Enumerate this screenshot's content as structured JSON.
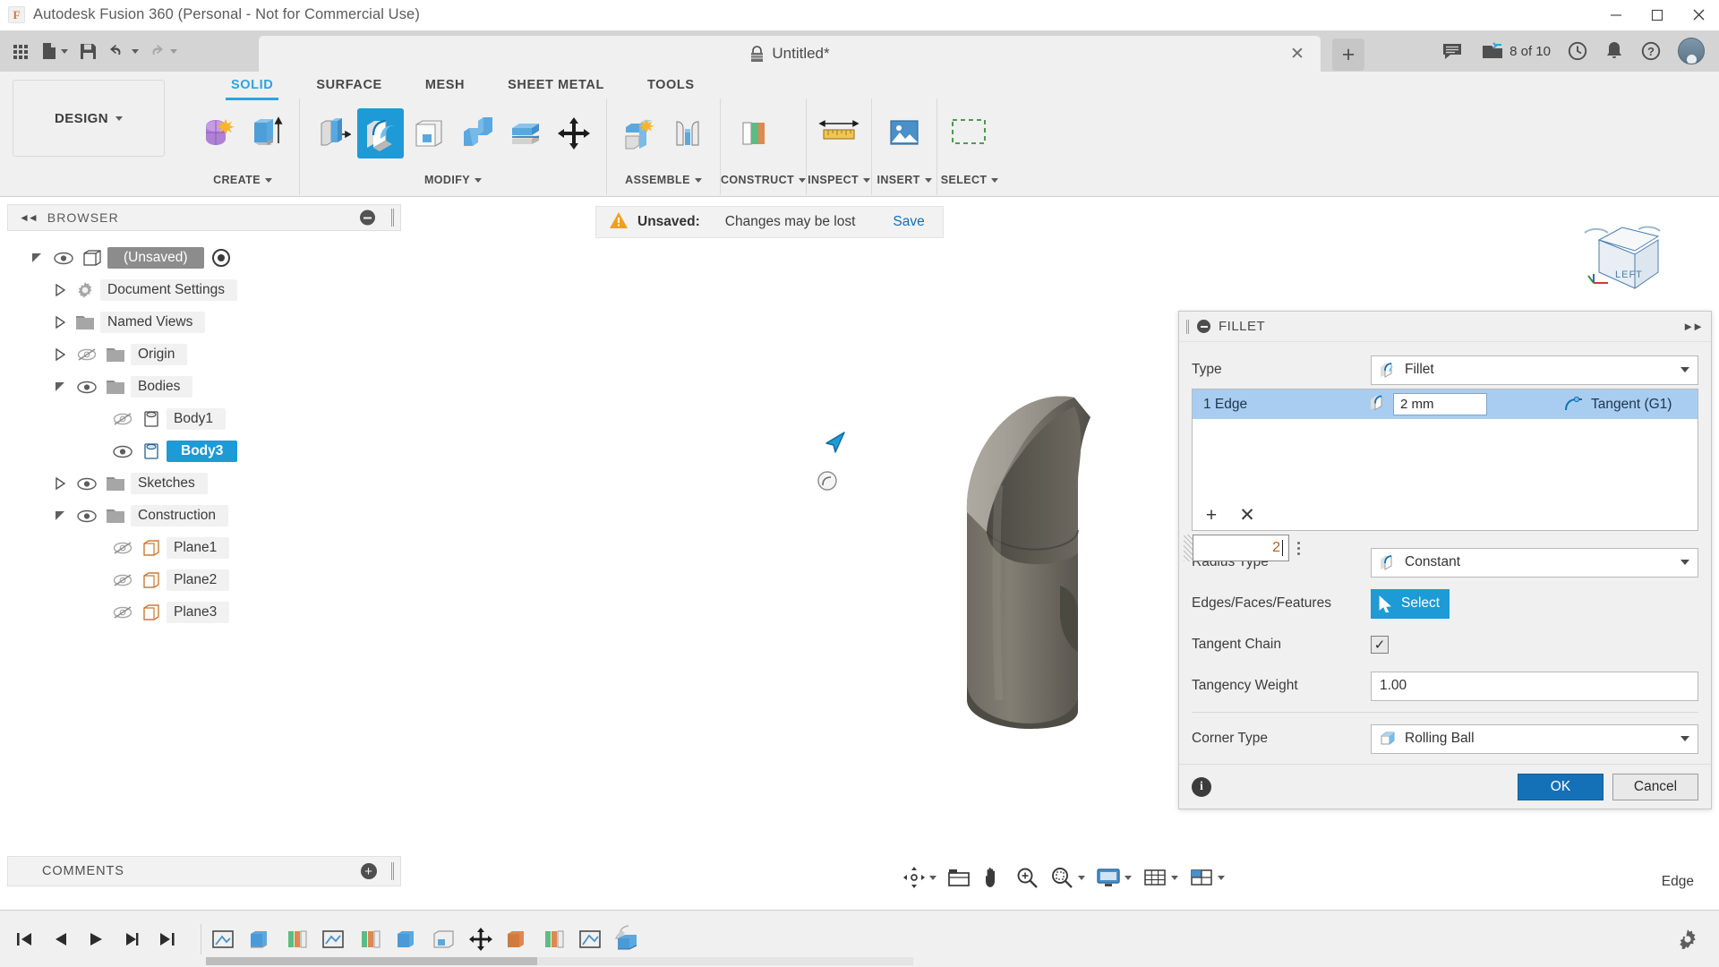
{
  "window": {
    "app_title": "Autodesk Fusion 360 (Personal - Not for Commercial Use)",
    "logo_letter": "F",
    "minimize": "—",
    "maximize": "❐",
    "close": "✕"
  },
  "quick_access": {
    "grid_label": "show-data-panel",
    "new_label": "new-file",
    "save_label": "save",
    "undo_label": "undo",
    "redo_label": "redo"
  },
  "document_tab": {
    "title": "Untitled*",
    "close": "✕",
    "new_tab": "+"
  },
  "top_right": {
    "jobs_text": "8 of 10",
    "comments_label": "comments",
    "recent_label": "recent",
    "notifications_label": "notifications",
    "help_label": "help",
    "account_label": "account"
  },
  "ribbon": {
    "workspace": "DESIGN",
    "tabs": [
      {
        "label": "SOLID",
        "active": true
      },
      {
        "label": "SURFACE",
        "active": false
      },
      {
        "label": "MESH",
        "active": false
      },
      {
        "label": "SHEET METAL",
        "active": false
      },
      {
        "label": "TOOLS",
        "active": false
      }
    ],
    "panels": [
      {
        "label": "CREATE",
        "has_caret": true
      },
      {
        "label": "MODIFY",
        "has_caret": true
      },
      {
        "label": "ASSEMBLE",
        "has_caret": true
      },
      {
        "label": "CONSTRUCT",
        "has_caret": true
      },
      {
        "label": "INSPECT",
        "has_caret": true
      },
      {
        "label": "INSERT",
        "has_caret": true
      },
      {
        "label": "SELECT",
        "has_caret": true
      }
    ]
  },
  "browser": {
    "header": "BROWSER",
    "tree": [
      {
        "label": "(Unsaved)",
        "indent": 0,
        "twist": "open",
        "eye": "on",
        "icon": "component-icon",
        "style": "root"
      },
      {
        "label": "Document Settings",
        "indent": 1,
        "twist": "closed",
        "eye": "none",
        "icon": "gear-icon",
        "style": "normal"
      },
      {
        "label": "Named Views",
        "indent": 1,
        "twist": "closed",
        "eye": "none",
        "icon": "folder-icon",
        "style": "normal"
      },
      {
        "label": "Origin",
        "indent": 1,
        "twist": "closed",
        "eye": "off",
        "icon": "folder-icon",
        "style": "normal"
      },
      {
        "label": "Bodies",
        "indent": 1,
        "twist": "open",
        "eye": "on",
        "icon": "folder-icon",
        "style": "normal"
      },
      {
        "label": "Body1",
        "indent": 2,
        "twist": "none",
        "eye": "off",
        "icon": "body-icon",
        "style": "normal"
      },
      {
        "label": "Body3",
        "indent": 2,
        "twist": "none",
        "eye": "on",
        "icon": "body-icon",
        "style": "selected"
      },
      {
        "label": "Sketches",
        "indent": 1,
        "twist": "closed",
        "eye": "on",
        "icon": "folder-icon",
        "style": "normal"
      },
      {
        "label": "Construction",
        "indent": 1,
        "twist": "open",
        "eye": "on",
        "icon": "folder-icon",
        "style": "normal"
      },
      {
        "label": "Plane1",
        "indent": 2,
        "twist": "none",
        "eye": "off",
        "icon": "plane-icon",
        "style": "normal"
      },
      {
        "label": "Plane2",
        "indent": 2,
        "twist": "none",
        "eye": "off",
        "icon": "plane-icon",
        "style": "normal"
      },
      {
        "label": "Plane3",
        "indent": 2,
        "twist": "none",
        "eye": "off",
        "icon": "plane-icon",
        "style": "normal"
      }
    ],
    "comments": "COMMENTS"
  },
  "canvas": {
    "unsaved_label": "Unsaved:",
    "unsaved_message": "Changes may be lost",
    "save_action": "Save",
    "viewcube_face": "LEFT",
    "status_right": "Edge"
  },
  "nav_toolbar": [
    {
      "name": "orbit-icon",
      "caret": true
    },
    {
      "name": "look-at-icon",
      "caret": false
    },
    {
      "name": "pan-icon",
      "caret": false
    },
    {
      "name": "zoom-icon",
      "caret": false
    },
    {
      "name": "fit-icon",
      "caret": true
    },
    {
      "name": "display-settings-icon",
      "caret": true
    },
    {
      "name": "grid-snap-icon",
      "caret": true
    },
    {
      "name": "viewports-icon",
      "caret": true
    }
  ],
  "dialog": {
    "title": "FILLET",
    "type_label": "Type",
    "type_value": "Fillet",
    "edge_row": {
      "count_label": "1 Edge",
      "radius_value": "2 mm",
      "continuity": "Tangent (G1)"
    },
    "add_button": "+",
    "remove_button": "✕",
    "floating_radius_value": "2",
    "radius_type_label": "Radius Type",
    "radius_type_value": "Constant",
    "selection_label": "Edges/Faces/Features",
    "select_button": "Select",
    "tangent_chain_label": "Tangent Chain",
    "tangent_chain_checked": "✓",
    "tangency_weight_label": "Tangency Weight",
    "tangency_weight_value": "1.00",
    "corner_type_label": "Corner Type",
    "corner_type_value": "Rolling Ball",
    "info_glyph": "i",
    "ok_button": "OK",
    "cancel_button": "Cancel"
  },
  "timeline": {
    "playback": [
      "go-to-beginning",
      "step-back",
      "play",
      "step-forward",
      "go-to-end"
    ],
    "features": [
      "sketch-feature",
      "extrude-feature",
      "revolve-feature",
      "sketch-feature-2",
      "revolve-feature-2",
      "extrude-feature-2",
      "shell-feature",
      "move-feature",
      "extrude-feature-3",
      "revolve-feature-3",
      "sketch-feature-3",
      "fillet-feature"
    ],
    "settings_label": "settings"
  },
  "colors": {
    "accent_blue": "#1e9ad6",
    "tab_active": "#2ea3dd",
    "selection_blue": "#a8cdf0",
    "link_blue": "#1070b8",
    "ok_button": "#1471b8",
    "model_gray": "#6a665d",
    "warning_amber": "#f0a020",
    "orange_value": "#b6601f"
  }
}
